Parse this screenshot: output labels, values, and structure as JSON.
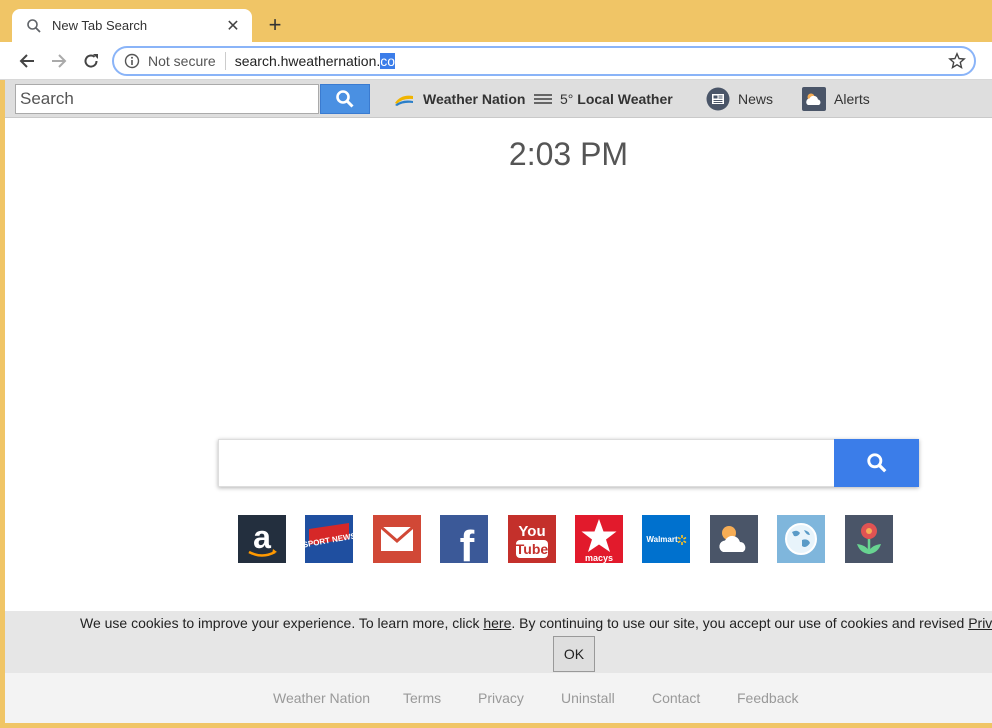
{
  "browser": {
    "tab_title": "New Tab Search",
    "new_tab_label": "+",
    "security_label": "Not secure",
    "url_main": "search.hweathernation.",
    "url_selected": "co"
  },
  "toolbar": {
    "search_placeholder": "Search",
    "weather_nation_label": "Weather Nation",
    "temperature": "5°",
    "local_weather_label": "Local Weather",
    "news_label": "News",
    "alerts_label": "Alerts"
  },
  "clock": {
    "time": "2:03 PM"
  },
  "main_search": {
    "value": ""
  },
  "tiles": [
    {
      "name": "amazon",
      "text": "a",
      "bg": "#232f3e"
    },
    {
      "name": "sport-news",
      "text": "SPORT NEWS",
      "bg": "#1f4fa0"
    },
    {
      "name": "gmail",
      "text": "",
      "bg": "#d14836"
    },
    {
      "name": "facebook",
      "text": "f",
      "bg": "#3b5998"
    },
    {
      "name": "youtube",
      "text": "You Tube",
      "bg": "#c4302b"
    },
    {
      "name": "macys",
      "text": "macys",
      "bg": "#e21a2c"
    },
    {
      "name": "walmart",
      "text": "Walmart",
      "bg": "#0071ce"
    },
    {
      "name": "weather",
      "text": "",
      "bg": "#4a5568"
    },
    {
      "name": "maps",
      "text": "",
      "bg": "#7fb6dc"
    },
    {
      "name": "flower",
      "text": "",
      "bg": "#4a5568"
    }
  ],
  "cookie": {
    "msg_before": "We use cookies to improve your experience. To learn more, click ",
    "link_here": "here",
    "msg_after": ". By continuing to use our site, you accept our use of cookies and revised ",
    "link_privacy": "Priv",
    "ok_label": "OK"
  },
  "footer": {
    "links": [
      "Weather Nation",
      "Terms",
      "Privacy",
      "Uninstall",
      "Contact",
      "Feedback"
    ]
  },
  "colors": {
    "chrome": "#f0c566",
    "accent": "#3b7de9",
    "toolbar": "#dedede"
  }
}
